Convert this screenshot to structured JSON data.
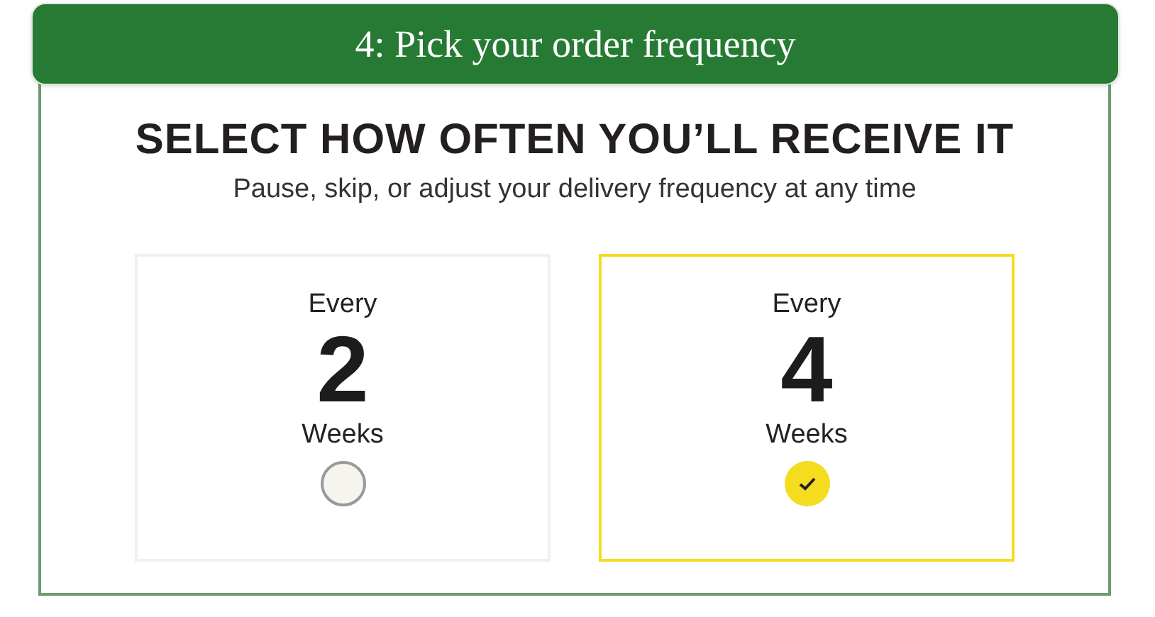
{
  "banner": {
    "title": "4: Pick your order frequency"
  },
  "heading": "SELECT HOW OFTEN YOU’LL RECEIVE IT",
  "subtitle": "Pause, skip, or adjust your delivery frequency at any time",
  "options": [
    {
      "prefix": "Every",
      "number": "2",
      "unit": "Weeks",
      "selected": false
    },
    {
      "prefix": "Every",
      "number": "4",
      "unit": "Weeks",
      "selected": true
    }
  ]
}
